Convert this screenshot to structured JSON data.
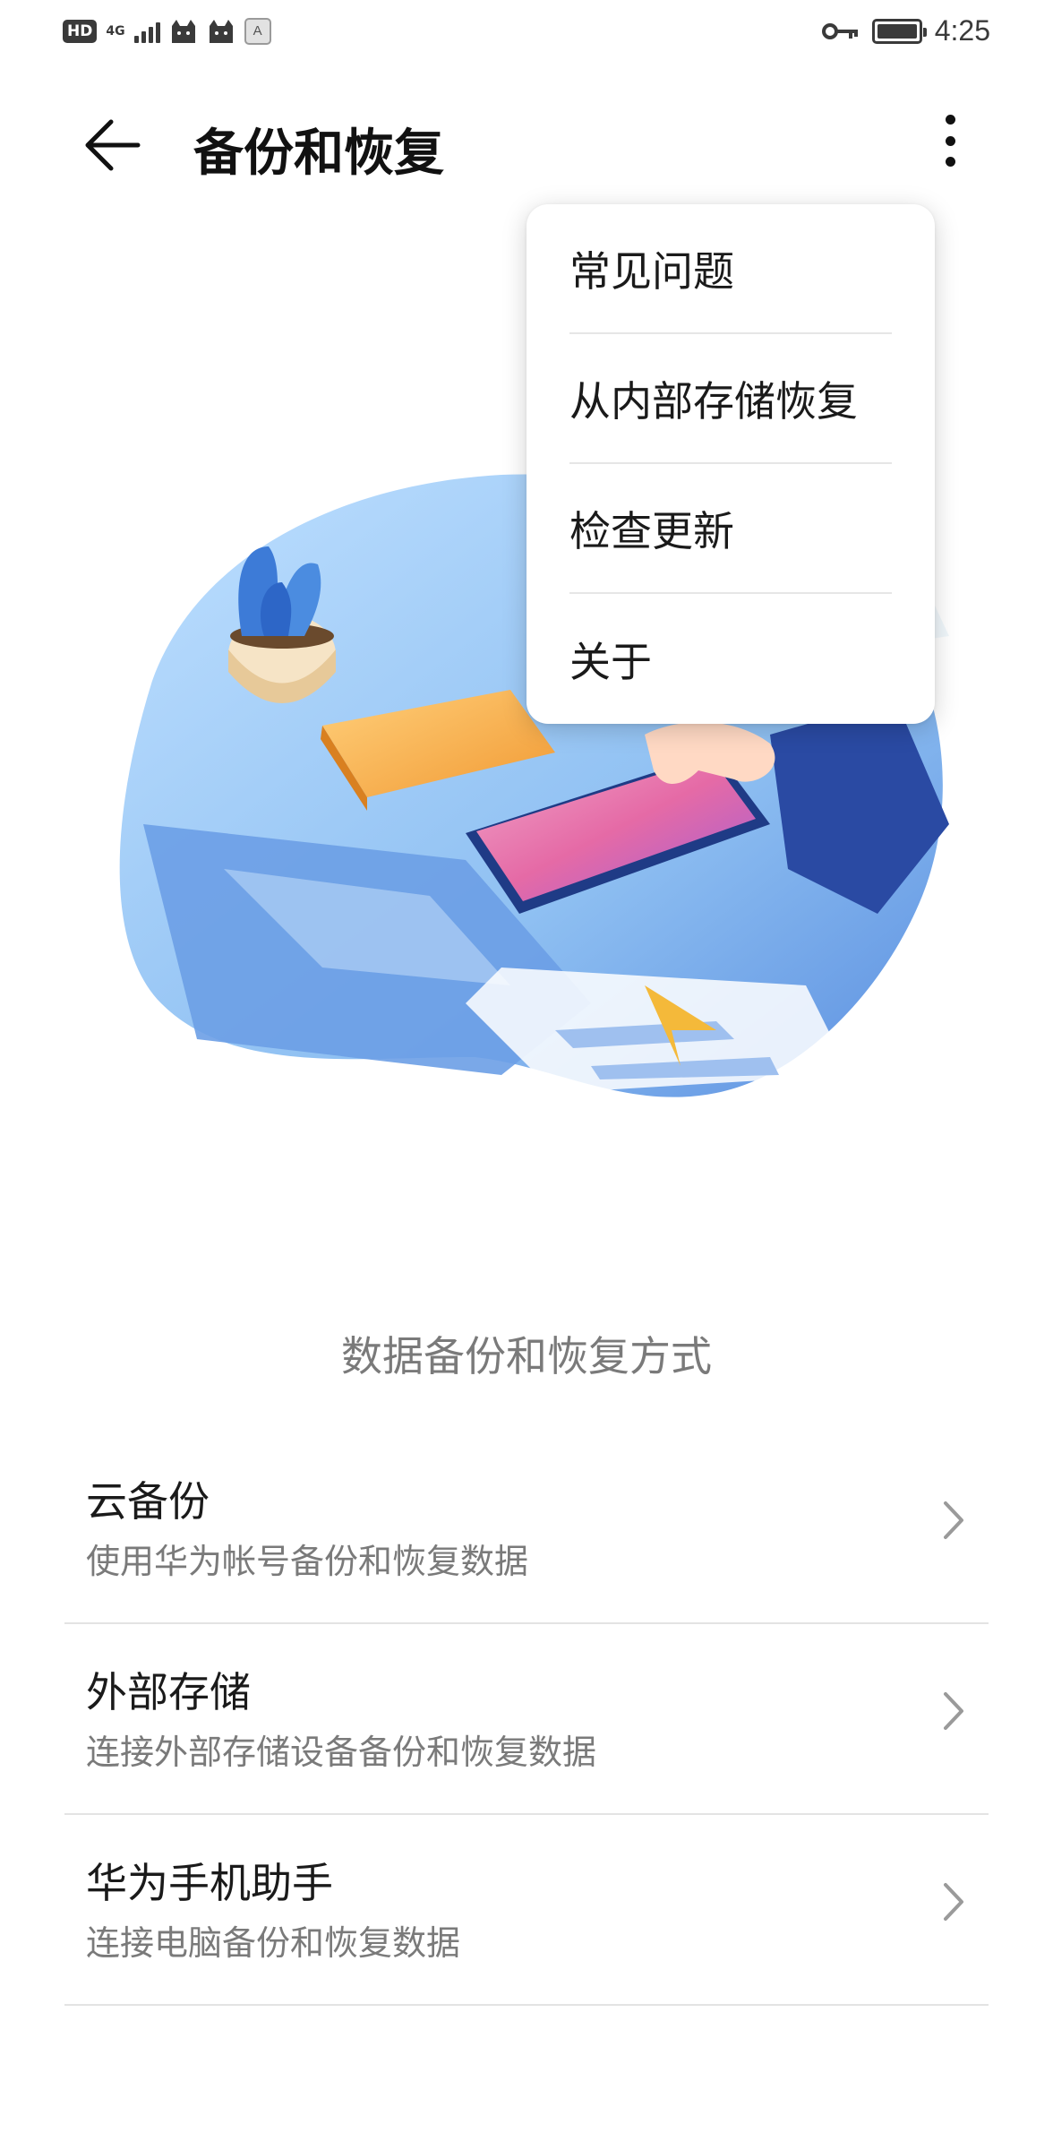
{
  "status_bar": {
    "hd_label": "HD",
    "network_label": "4G",
    "a_badge": "A",
    "time": "4:25",
    "icons": [
      "hd-icon",
      "signal-icon",
      "cat-icon",
      "cat-icon",
      "a-icon",
      "key-icon",
      "battery-icon"
    ]
  },
  "header": {
    "title": "备份和恢复",
    "back_icon": "arrow-left-icon",
    "more_icon": "more-vertical-icon"
  },
  "menu": {
    "items": [
      {
        "label": "常见问题"
      },
      {
        "label": "从内部存储恢复"
      },
      {
        "label": "检查更新"
      },
      {
        "label": "关于"
      }
    ]
  },
  "section": {
    "title": "数据备份和恢复方式"
  },
  "options": [
    {
      "title": "云备份",
      "subtitle": "使用华为帐号备份和恢复数据"
    },
    {
      "title": "外部存储",
      "subtitle": "连接外部存储设备备份和恢复数据"
    },
    {
      "title": "华为手机助手",
      "subtitle": "连接电脑备份和恢复数据"
    }
  ],
  "colors": {
    "accent_blue": "#4a7fd9",
    "text_primary": "#1a1a1a",
    "text_secondary": "#7a7a7a",
    "divider": "#e3e3e3"
  }
}
